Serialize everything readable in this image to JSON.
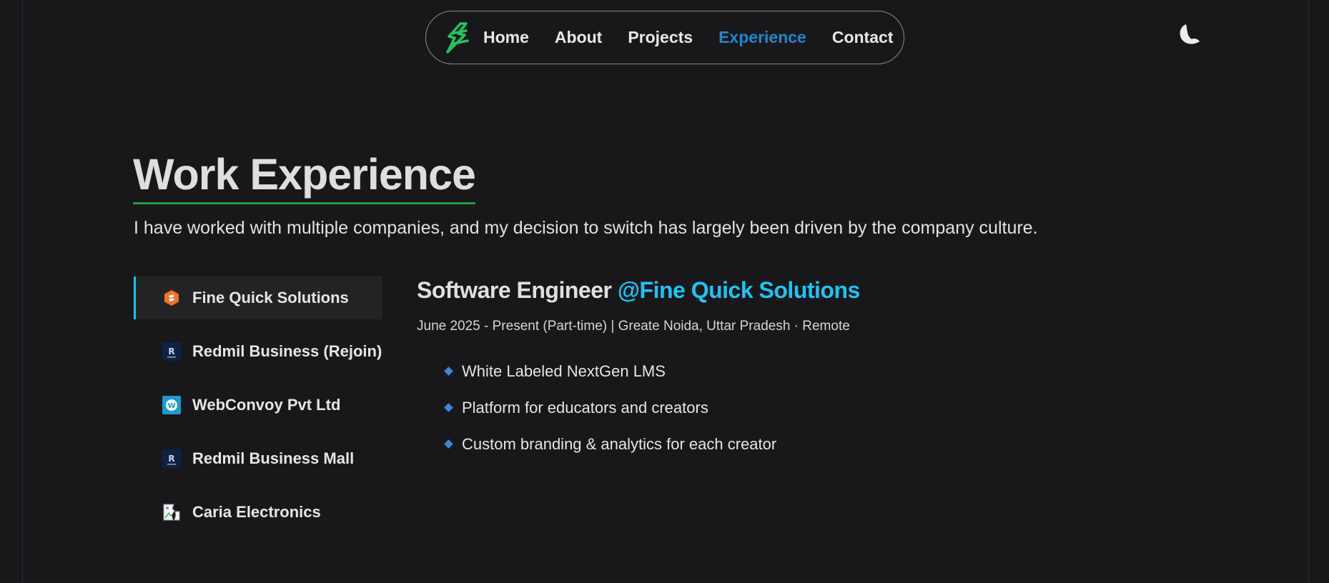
{
  "nav": {
    "logo_icon": "lightning-logo-icon",
    "links": [
      {
        "label": "Home",
        "active": false
      },
      {
        "label": "About",
        "active": false
      },
      {
        "label": "Projects",
        "active": false
      },
      {
        "label": "Experience",
        "active": true
      },
      {
        "label": "Contact",
        "active": false
      }
    ],
    "theme_icon": "moon-icon"
  },
  "section": {
    "title": "Work Experience",
    "subtitle": "I have worked with multiple companies, and my decision to switch has largely been driven by the company culture."
  },
  "companies": [
    {
      "name": "Fine Quick Solutions",
      "icon": "fine-quick-logo-icon",
      "active": true
    },
    {
      "name": "Redmil Business (Rejoin)",
      "icon": "redmil-logo-icon",
      "active": false
    },
    {
      "name": "WebConvoy Pvt Ltd",
      "icon": "webconvoy-logo-icon",
      "active": false
    },
    {
      "name": "Redmil Business Mall",
      "icon": "redmil-logo-icon",
      "active": false
    },
    {
      "name": "Caria Electronics",
      "icon": "broken-image-icon",
      "active": false
    }
  ],
  "detail": {
    "role": "Software Engineer",
    "company": "@Fine Quick Solutions",
    "meta": "June 2025 - Present (Part-time) | Greate Noida, Uttar Pradesh · Remote",
    "bullets": [
      "White Labeled NextGen LMS",
      "Platform for educators and creators",
      "Custom branding & analytics for each creator"
    ]
  },
  "colors": {
    "background": "#18181b",
    "accent_blue": "#1ec4f0",
    "nav_active": "#1b89c9",
    "title_underline": "#1e9a3f",
    "logo_green": "#22c55e",
    "bullet": "#3d86d8"
  }
}
